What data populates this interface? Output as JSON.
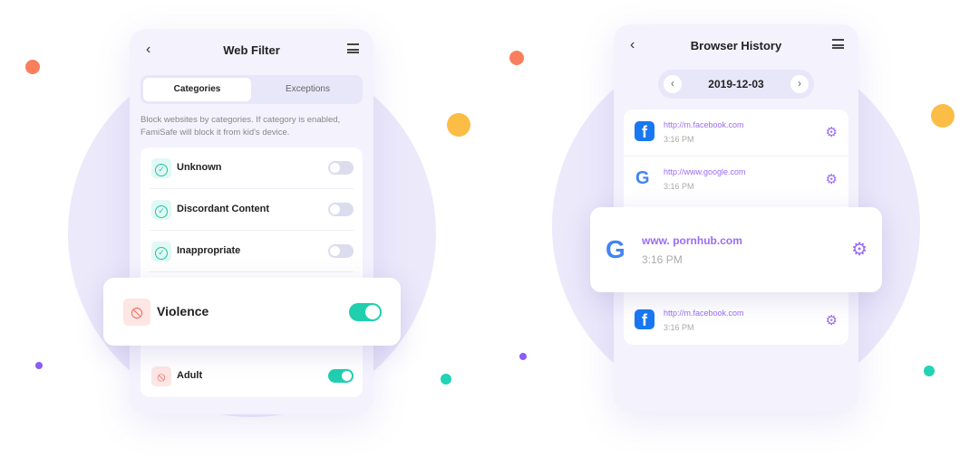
{
  "colors": {
    "accent": "#9b6cf5",
    "toggle_on": "#1fcfae",
    "danger": "#f05a4b",
    "orange": "#f97e5e",
    "yellow": "#fbbd45",
    "teal": "#22d3b5",
    "purple": "#8b5cf6"
  },
  "web_filter": {
    "title": "Web Filter",
    "tabs": [
      {
        "label": "Categories",
        "active": true
      },
      {
        "label": "Exceptions",
        "active": false
      }
    ],
    "description": "Block websites by categories. If category is enabled, FamiSafe will block it from kid's device.",
    "categories": [
      {
        "label": "Unknown",
        "enabled": false,
        "icon": "check-circle-icon"
      },
      {
        "label": "Discordant Content",
        "enabled": false,
        "icon": "check-circle-icon"
      },
      {
        "label": "Inappropriate",
        "enabled": false,
        "icon": "check-circle-icon"
      },
      {
        "label": "Violence",
        "enabled": true,
        "icon": "ban-icon"
      },
      {
        "label": "Adult",
        "enabled": true,
        "icon": "ban-icon"
      }
    ]
  },
  "browser_history": {
    "title": "Browser History",
    "date": "2019-12-03",
    "entries": [
      {
        "url": "http://m.facebook.com",
        "time": "3:16 PM",
        "icon": "facebook-icon"
      },
      {
        "url": "http://www.google.com",
        "time": "3:16 PM",
        "icon": "google-icon"
      },
      {
        "url": "www. pornhub.com",
        "time": "3:16 PM",
        "icon": "google-icon"
      },
      {
        "url": "http://m.facebook.com",
        "time": "3:16 PM",
        "icon": "facebook-icon"
      }
    ]
  }
}
